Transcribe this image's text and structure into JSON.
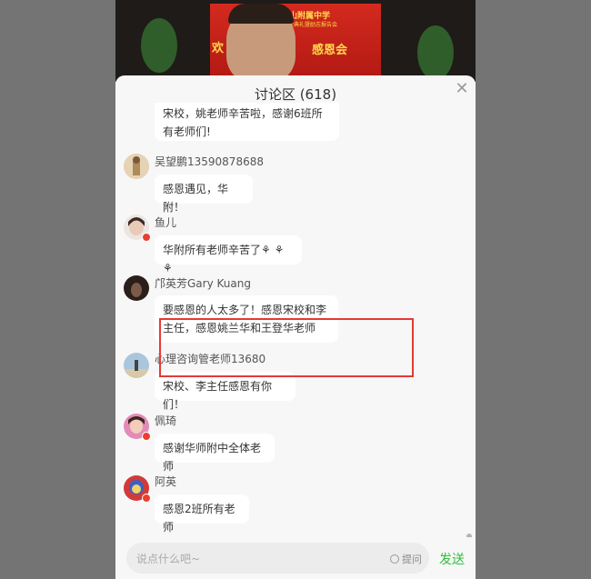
{
  "video": {
    "banner_line1": "中山附属中学",
    "banner_line2": "毕业典礼暨励志报告会",
    "banner_left": "欢",
    "banner_right": "感恩会"
  },
  "panel": {
    "title": "讨论区 (618)",
    "close_icon": "close-icon"
  },
  "messages": [
    {
      "name": "",
      "text": "宋校，姚老师辛苦啦，感谢6班所有老师们!"
    },
    {
      "name": "吴望鹏13590878688",
      "text": "感恩遇见，华附！"
    },
    {
      "name": "鱼儿",
      "text": "华附所有老师辛苦了⚘ ⚘ ⚘"
    },
    {
      "name": "邝英芳Gary Kuang",
      "text": "要感恩的人太多了！感恩宋校和李主任，感恩姚兰华和王登华老师"
    },
    {
      "name": "心理咨询管老师13680",
      "text": "宋校、李主任感恩有你们！"
    },
    {
      "name": "佩琦",
      "text": "感谢华师附中全体老师"
    },
    {
      "name": "阿英",
      "text": "感恩2班所有老师"
    }
  ],
  "input": {
    "placeholder": "说点什么吧~",
    "ask_label": "提问",
    "send_label": "发送"
  },
  "colors": {
    "send": "#2fbf3a",
    "highlight": "#e53935"
  }
}
